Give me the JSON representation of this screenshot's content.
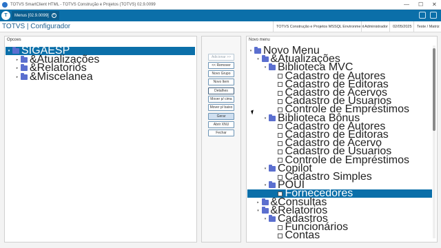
{
  "window": {
    "title": "TOTVS SmartClient HTML - TOTVS Construção e Projetos (TOTVS) 02.9.0099",
    "controls": [
      "—",
      "☐",
      "✕"
    ]
  },
  "tab": {
    "label": "Menus [02.9.0099]",
    "close": "×"
  },
  "header": {
    "title": "TOTVS | Configurador",
    "company": "TOTVS Construção e Projetos MSSQL Environment",
    "user": "Administrador",
    "date": "02/05/2025",
    "env": "Teste / Matriz"
  },
  "left_panel": {
    "title": "Opcoes",
    "tree": [
      {
        "label": "SIGAESP",
        "level": 0,
        "caret": "▾",
        "selected": true
      },
      {
        "label": "&Atualizações",
        "level": 1,
        "caret": "▸"
      },
      {
        "label": "&Relatorios",
        "level": 1,
        "caret": "▸"
      },
      {
        "label": "&Miscelanea",
        "level": 1,
        "caret": "▸"
      }
    ]
  },
  "buttons": [
    {
      "label": "Adicionar >>",
      "state": "disabled"
    },
    {
      "label": "<< Remover",
      "state": "normal"
    },
    {
      "label": "Novo Grupo",
      "state": "normal"
    },
    {
      "label": "Novo Item",
      "state": "normal"
    },
    {
      "label": "Detalhes",
      "state": "focused"
    },
    {
      "label": "Mover p/ cima",
      "state": "normal"
    },
    {
      "label": "Mover p/ baixo",
      "state": "normal"
    },
    {
      "label": "Gerar",
      "state": "primary"
    },
    {
      "label": "Abrir XNU",
      "state": "normal"
    },
    {
      "label": "Fechar",
      "state": "normal"
    }
  ],
  "right_panel": {
    "title": "Novo menu",
    "tree": [
      {
        "label": "Novo Menu",
        "level": 0,
        "type": "folder",
        "caret": "▾"
      },
      {
        "label": "&Atualizações",
        "level": 1,
        "type": "folder",
        "caret": "▾"
      },
      {
        "label": "Biblioteca MVC",
        "level": 2,
        "type": "folder",
        "caret": "▾"
      },
      {
        "label": "Cadastro de Autores",
        "level": 3,
        "type": "file"
      },
      {
        "label": "Cadastro de Editoras",
        "level": 3,
        "type": "file"
      },
      {
        "label": "Cadastro de Acervos",
        "level": 3,
        "type": "file"
      },
      {
        "label": "Cadastro de Usuarios",
        "level": 3,
        "type": "file"
      },
      {
        "label": "Controle de Empréstimos",
        "level": 3,
        "type": "file"
      },
      {
        "label": "Biblioteca Bônus",
        "level": 2,
        "type": "folder",
        "caret": "▾"
      },
      {
        "label": "Cadastro de Autores",
        "level": 3,
        "type": "file"
      },
      {
        "label": "Cadastro de Editoras",
        "level": 3,
        "type": "file"
      },
      {
        "label": "Cadastro de Acervo",
        "level": 3,
        "type": "file"
      },
      {
        "label": "Cadastro de Usuarios",
        "level": 3,
        "type": "file"
      },
      {
        "label": "Controle de Empréstimos",
        "level": 3,
        "type": "file"
      },
      {
        "label": "Copilot",
        "level": 2,
        "type": "folder",
        "caret": "▾"
      },
      {
        "label": "Cadastro Simples",
        "level": 3,
        "type": "file"
      },
      {
        "label": "POUI",
        "level": 2,
        "type": "folder",
        "caret": "▾"
      },
      {
        "label": "Fornecedores",
        "level": 3,
        "type": "file",
        "selected": true
      },
      {
        "label": "&Consultas",
        "level": 1,
        "type": "folder",
        "caret": "▸"
      },
      {
        "label": "&Relatorios",
        "level": 1,
        "type": "folder",
        "caret": "▾"
      },
      {
        "label": "Cadastros",
        "level": 2,
        "type": "folder",
        "caret": "▾"
      },
      {
        "label": "Funcionários",
        "level": 3,
        "type": "file"
      },
      {
        "label": "Contas",
        "level": 3,
        "type": "file"
      }
    ]
  },
  "colors": {
    "accent": "#0b6fa9",
    "folder": "#5b6fcf"
  }
}
